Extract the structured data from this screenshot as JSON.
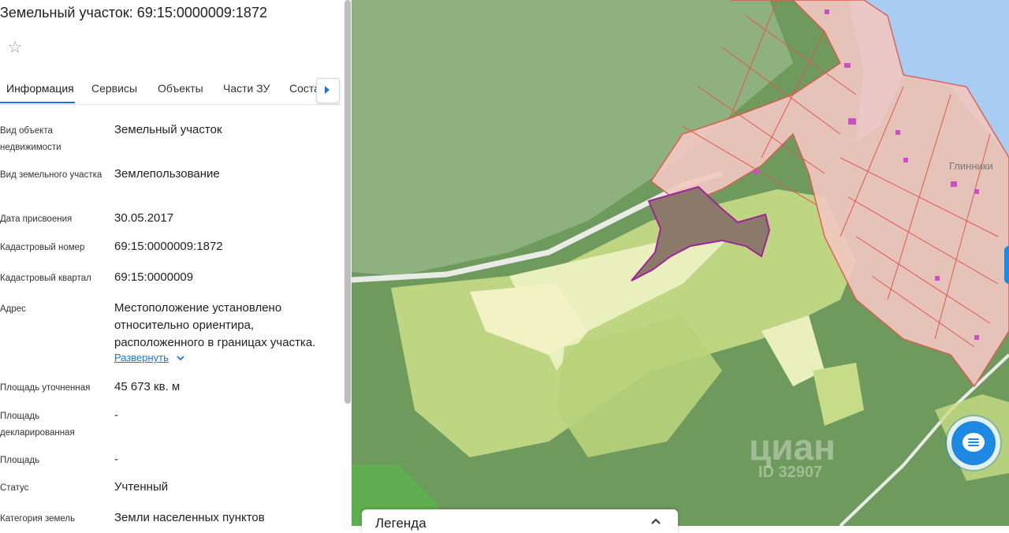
{
  "panel": {
    "title": "Земельный участок: 69:15:0000009:1872",
    "tabs": [
      {
        "label": "Информация"
      },
      {
        "label": "Сервисы"
      },
      {
        "label": "Объекты"
      },
      {
        "label": "Части ЗУ"
      },
      {
        "label": "Соста"
      }
    ],
    "rows": [
      {
        "label": "Вид объекта недвижимости",
        "value": "Земельный участок"
      },
      {
        "label": "Вид земельного участка",
        "value": "Землепользование"
      },
      {
        "label": "Дата присвоения",
        "value": "30.05.2017"
      },
      {
        "label": "Кадастровый номер",
        "value": "69:15:0000009:1872"
      },
      {
        "label": "Кадастровый квартал",
        "value": "69:15:0000009"
      },
      {
        "label": "Адрес",
        "value": "Местоположение установлено относительно ориентира, расположенного в границах участка."
      },
      {
        "label": "Площадь уточненная",
        "value": "45 673 кв. м"
      },
      {
        "label": "Площадь декларированная",
        "value": "-"
      },
      {
        "label": "Площадь",
        "value": "-"
      },
      {
        "label": "Статус",
        "value": "Учтенный"
      },
      {
        "label": "Категория земель",
        "value": "Земли населенных пунктов"
      }
    ],
    "expand_label": "Развернуть"
  },
  "map": {
    "place_label": "Глинники",
    "watermark": "циан",
    "watermark_id": "ID 32907",
    "legend_label": "Легенда",
    "colors": {
      "forest": "#6f9a5d",
      "field": "#c7dc86",
      "selected_parcel": "#8b7a6a",
      "parcel_outline": "#e2574c",
      "water": "#a9cdf2",
      "accent": "#1e88e5"
    }
  },
  "icons": {
    "favorite": "star-icon",
    "tab_scroll": "chevron-right-icon",
    "expand": "chevron-down-icon",
    "chat": "chat-icon",
    "legend_toggle": "chevron-up-icon"
  }
}
